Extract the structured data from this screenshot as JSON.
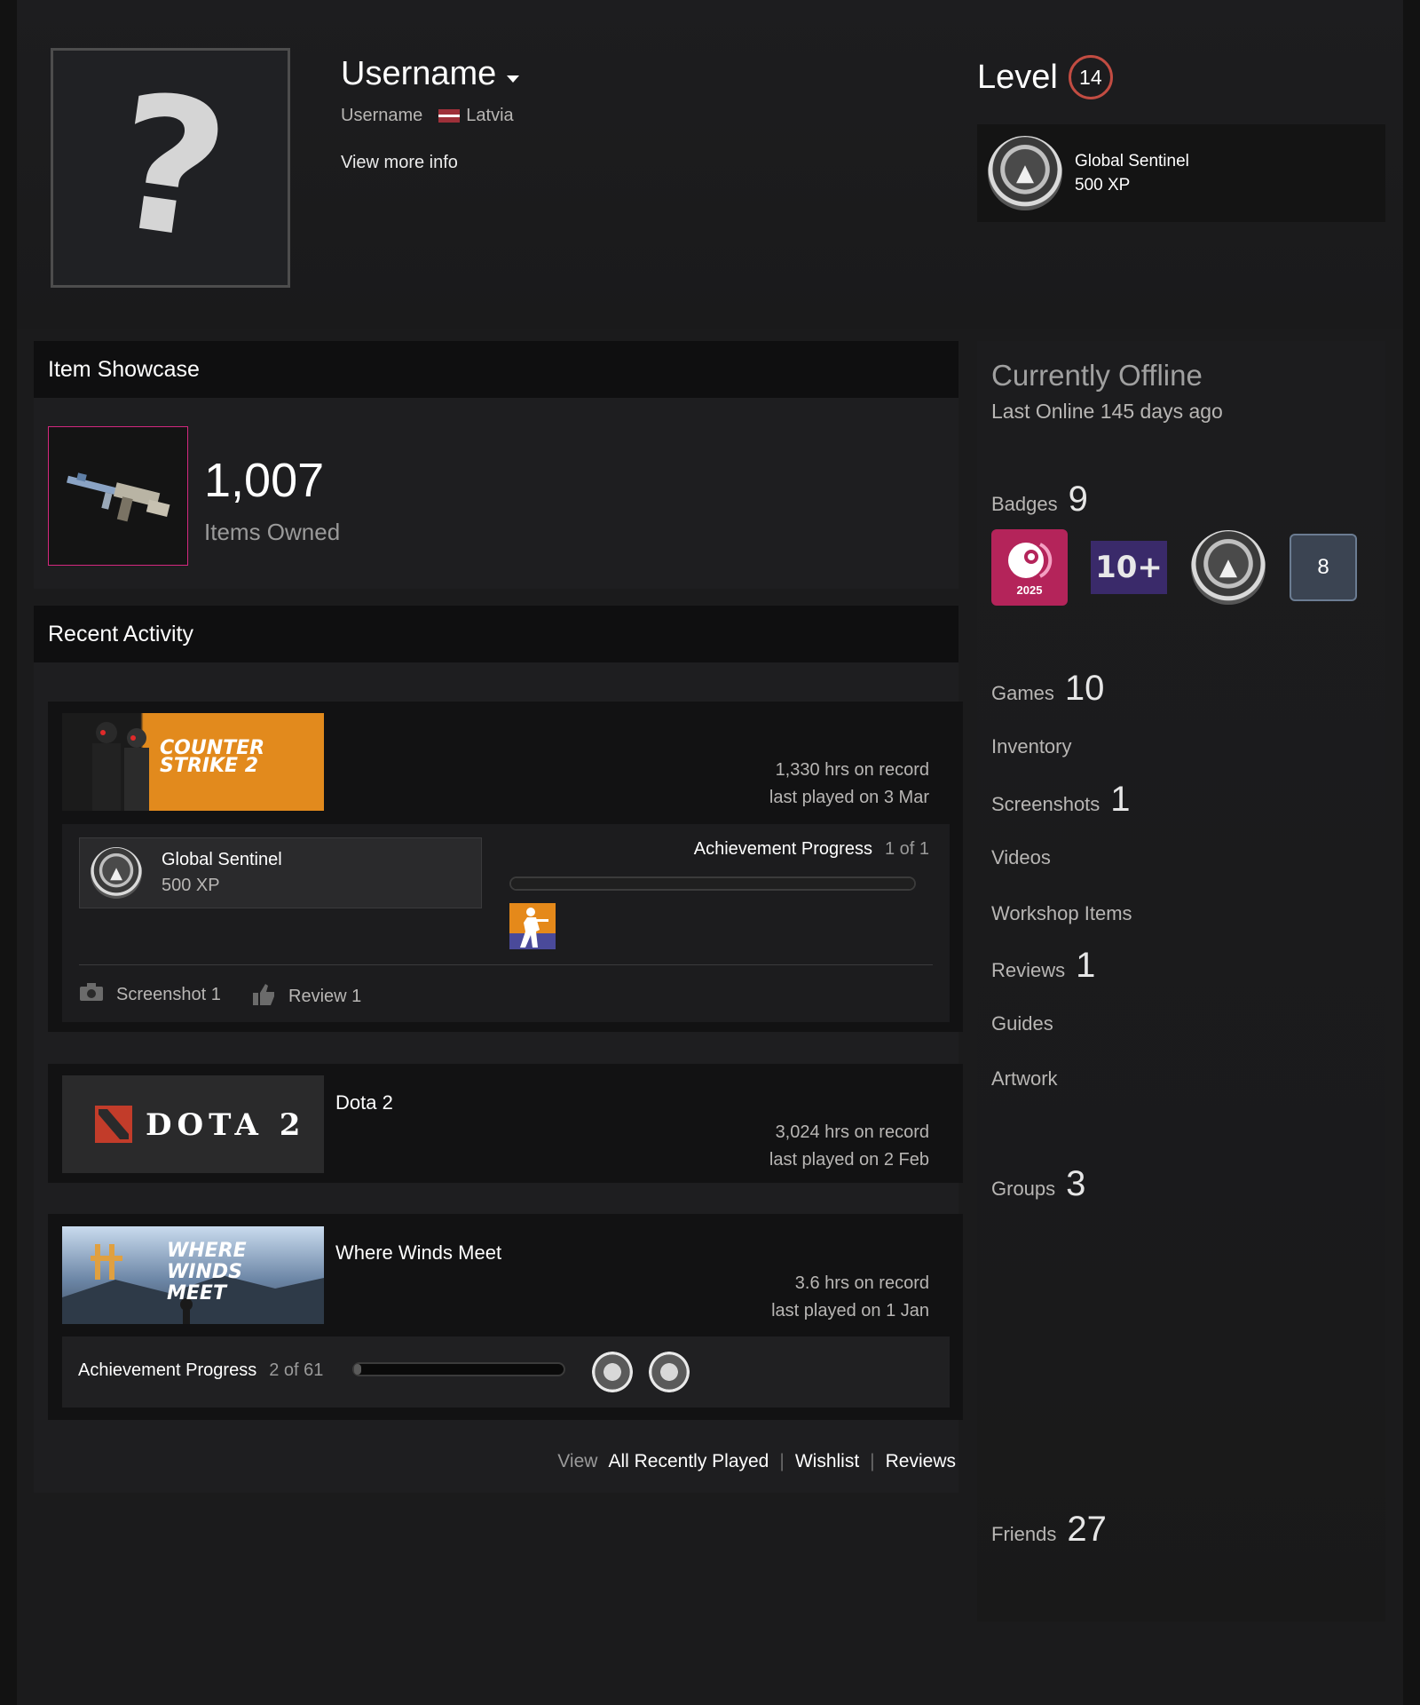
{
  "profile": {
    "display_name": "Username",
    "account_name": "Username",
    "country": "Latvia",
    "more_info": "View more info",
    "avatar_glyph": "?"
  },
  "level": {
    "label": "Level",
    "value": "14",
    "accent_color": "#c24c42"
  },
  "favorite_badge": {
    "name": "Global Sentinel",
    "xp": "500 XP"
  },
  "item_showcase": {
    "title": "Item Showcase",
    "count": "1,007",
    "label": "Items Owned",
    "frame_color": "#d3287e"
  },
  "recent_activity": {
    "title": "Recent Activity",
    "games": [
      {
        "capsule_text": "COUNTER STRIKE 2",
        "hours": "1,330 hrs on record",
        "last_played": "last played on 3 Mar",
        "badge_name": "Global Sentinel",
        "badge_xp": "500 XP",
        "ach_label": "Achievement Progress",
        "ach_count": "1 of 1",
        "screenshot_link": "Screenshot 1",
        "review_link": "Review 1"
      },
      {
        "name": "Dota 2",
        "capsule_text": "DOTA 2",
        "hours": "3,024 hrs on record",
        "last_played": "last played on 2 Feb"
      },
      {
        "name": "Where Winds Meet",
        "capsule_text": "WHERE WINDS MEET",
        "hours": "3.6 hrs on record",
        "last_played": "last played on 1 Jan",
        "ach_label": "Achievement Progress",
        "ach_count": "2 of 61"
      }
    ],
    "view_label": "View",
    "links": [
      "All Recently Played",
      "Wishlist",
      "Reviews"
    ]
  },
  "sidebar": {
    "status": "Currently Offline",
    "last_online": "Last Online 145 days ago",
    "badges_label": "Badges",
    "badges_count": "9",
    "badge_tiles": [
      "2025",
      "10+",
      "",
      "8"
    ],
    "items": [
      {
        "label": "Games",
        "count": "10"
      },
      {
        "label": "Inventory",
        "count": ""
      },
      {
        "label": "Screenshots",
        "count": "1"
      },
      {
        "label": "Videos",
        "count": ""
      },
      {
        "label": "Workshop Items",
        "count": ""
      },
      {
        "label": "Reviews",
        "count": "1"
      },
      {
        "label": "Guides",
        "count": ""
      },
      {
        "label": "Artwork",
        "count": ""
      },
      {
        "label": "Groups",
        "count": "3"
      },
      {
        "label": "Friends",
        "count": "27"
      }
    ]
  }
}
